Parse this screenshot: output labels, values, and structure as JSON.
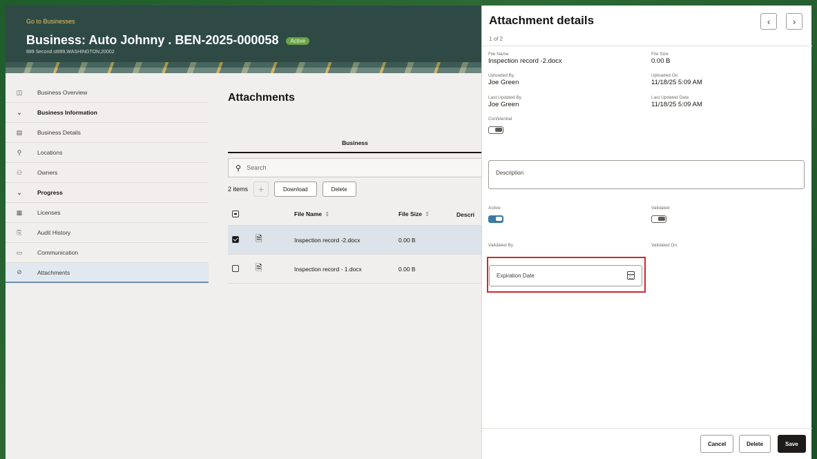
{
  "header": {
    "go_to": "Go to Businesses",
    "title": "Business: Auto Johnny . BEN-2025-000058",
    "badge": "Active",
    "address": "899 Second st999,WASHINGTON,20002"
  },
  "sidebar": {
    "items": [
      {
        "label": "Business Overview",
        "icon": "overview-icon"
      },
      {
        "label": "Business Information",
        "icon": "chevron-down-icon"
      },
      {
        "label": "Business Details",
        "icon": "building-icon"
      },
      {
        "label": "Locations",
        "icon": "location-pin-icon"
      },
      {
        "label": "Owners",
        "icon": "owners-icon"
      },
      {
        "label": "Progress",
        "icon": "chevron-down-icon"
      },
      {
        "label": "Licenses",
        "icon": "license-icon"
      },
      {
        "label": "Audit History",
        "icon": "audit-icon"
      },
      {
        "label": "Communication",
        "icon": "message-icon"
      },
      {
        "label": "Attachments",
        "icon": "paperclip-icon"
      }
    ]
  },
  "content": {
    "title": "Attachments",
    "tab": "Business",
    "search_placeholder": "Search",
    "items_count": "2 items",
    "download": "Download",
    "delete": "Delete",
    "columns": {
      "file_name": "File Name",
      "file_size": "File Size",
      "description": "Descri"
    },
    "rows": [
      {
        "name": "Inspection record -2.docx",
        "size": "0.00 B"
      },
      {
        "name": "Inspection record - 1.docx",
        "size": "0.00 B"
      }
    ]
  },
  "drawer": {
    "title": "Attachment details",
    "count": "1 of 2",
    "file_name_label": "File Name",
    "file_name": "Inspection record -2.docx",
    "file_size_label": "File Size",
    "file_size": "0.00 B",
    "uploaded_by_label": "Uploaded By",
    "uploaded_by": "Joe Green",
    "uploaded_on_label": "Uploaded On",
    "uploaded_on": "11/18/25 5:09 AM",
    "last_updated_by_label": "Last Updated By",
    "last_updated_by": "Joe Green",
    "last_updated_date_label": "Last Updated Date",
    "last_updated_date": "11/18/25 5:09 AM",
    "confidential_label": "Confidential",
    "description_label": "Description",
    "active_label": "Active",
    "validated_label": "Validated",
    "validated_by_label": "Validated By",
    "validated_on_label": "Validated On",
    "expiration_label": "Expiration Date",
    "cancel": "Cancel",
    "delete": "Delete",
    "save": "Save"
  }
}
